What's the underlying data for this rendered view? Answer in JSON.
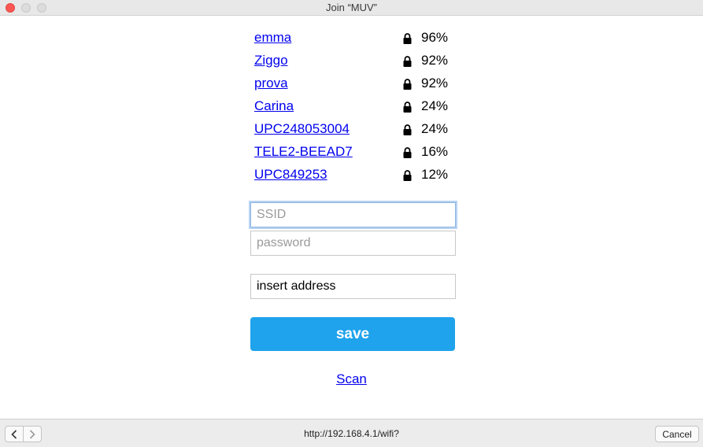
{
  "window": {
    "title": "Join “MUV”"
  },
  "networks": [
    {
      "ssid": "emma",
      "signal": "96%"
    },
    {
      "ssid": "Ziggo",
      "signal": "92%"
    },
    {
      "ssid": "prova",
      "signal": "92%"
    },
    {
      "ssid": "Carina",
      "signal": "24%"
    },
    {
      "ssid": "UPC248053004",
      "signal": "24%"
    },
    {
      "ssid": "TELE2-BEEAD7",
      "signal": "16%"
    },
    {
      "ssid": "UPC849253",
      "signal": "12%"
    }
  ],
  "form": {
    "ssid_placeholder": "SSID",
    "ssid_value": "",
    "password_placeholder": "password",
    "password_value": "",
    "address_value": "insert address",
    "save_label": "save",
    "scan_label": "Scan"
  },
  "bottombar": {
    "url": "http://192.168.4.1/wifi?",
    "cancel_label": "Cancel"
  },
  "colors": {
    "accent": "#1fa3ec",
    "link": "#0000ee",
    "close_button": "#fc5753"
  },
  "icons": [
    "lock-icon",
    "back-arrow-icon",
    "forward-arrow-icon"
  ]
}
